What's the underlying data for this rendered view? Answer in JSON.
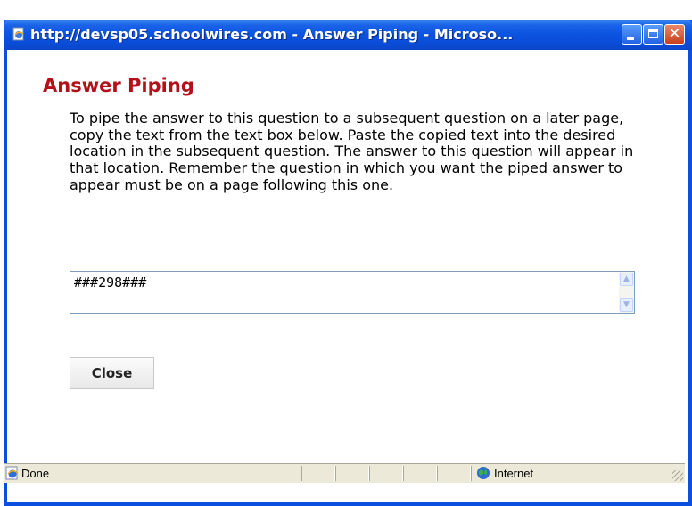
{
  "window": {
    "title": "http://devsp05.schoolwires.com - Answer Piping - Microso...",
    "title_icon": "ie-page-icon",
    "buttons": [
      "minimize",
      "maximize",
      "close"
    ]
  },
  "dialog": {
    "heading": "Answer Piping",
    "instructions": "To pipe the answer to this question to a subsequent question on a later page, copy the text from the text box below. Paste the copied text into the desired location in the subsequent question. The answer to this question will appear in that location. Remember the question in which you want the piped answer to appear must be on a page following this one.",
    "textbox_value": "###298###",
    "close_label": "Close"
  },
  "statusbar": {
    "status_text": "Done",
    "zone_text": "Internet",
    "status_icon": "ie-done-icon",
    "zone_icon": "globe-icon"
  },
  "colors": {
    "titlebar": "#0b53e0",
    "heading": "#b3101a",
    "statusbar_bg": "#ece9d8"
  }
}
